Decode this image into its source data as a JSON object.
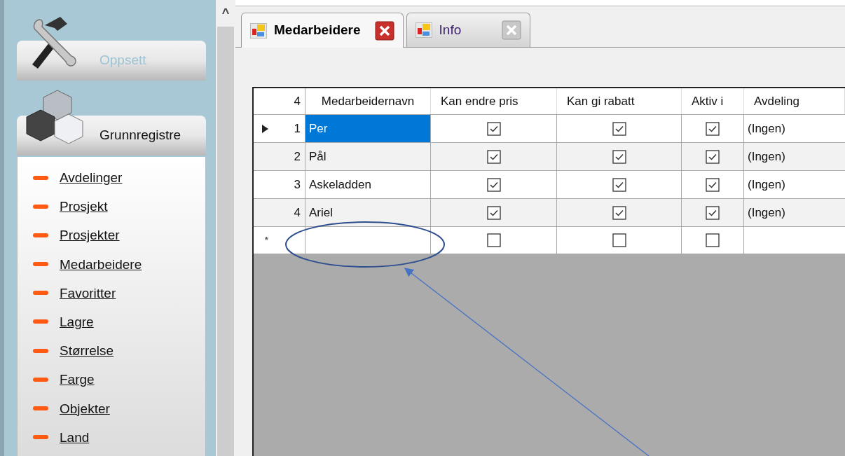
{
  "sidebar": {
    "sections": [
      {
        "title": "Oppsett",
        "expanded": false
      },
      {
        "title": "Grunnregistre",
        "expanded": true,
        "items": [
          "Avdelinger",
          "Prosjekt",
          "Prosjekter",
          "Medarbeidere",
          "Favoritter",
          "Lagre",
          "Størrelse",
          "Farge",
          "Objekter",
          "Land"
        ]
      }
    ]
  },
  "scrollbar": {
    "up_arrow": "^"
  },
  "tabs": [
    {
      "label": "Medarbeidere",
      "selected": true
    },
    {
      "label": "Info",
      "selected": false
    }
  ],
  "grid": {
    "row_count": "4",
    "columns": [
      "Medarbeidernavn",
      "Kan endre pris",
      "Kan gi rabatt",
      "Aktiv i",
      "Avdeling"
    ],
    "rows": [
      {
        "number": "1",
        "name": "Per",
        "can_change_price": true,
        "can_give_discount": true,
        "active": true,
        "department": "(Ingen)",
        "selected": true
      },
      {
        "number": "2",
        "name": "Pål",
        "can_change_price": true,
        "can_give_discount": true,
        "active": true,
        "department": "(Ingen)",
        "selected": false
      },
      {
        "number": "3",
        "name": "Askeladden",
        "can_change_price": true,
        "can_give_discount": true,
        "active": true,
        "department": "(Ingen)",
        "selected": false
      },
      {
        "number": "4",
        "name": "Ariel",
        "can_change_price": true,
        "can_give_discount": true,
        "active": true,
        "department": "(Ingen)",
        "selected": false
      }
    ],
    "new_row": {
      "marker": "*",
      "can_change_price": false,
      "can_give_discount": false,
      "active": false
    }
  }
}
